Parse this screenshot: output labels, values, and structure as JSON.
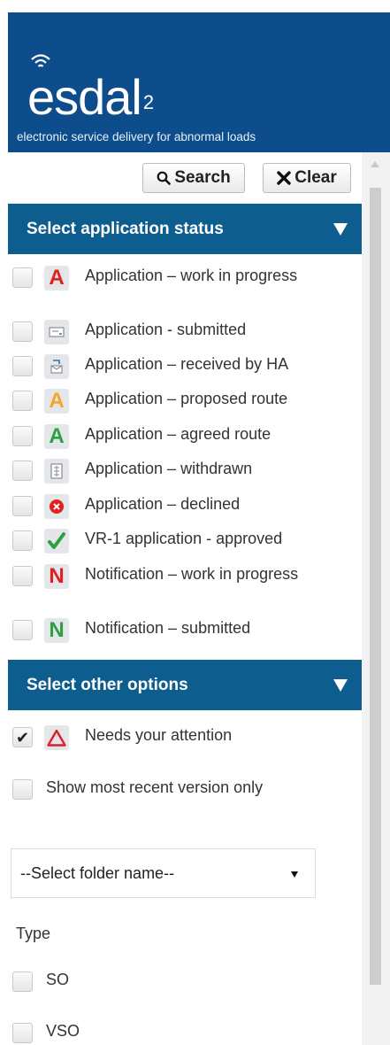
{
  "header": {
    "logo_text": "esdal",
    "logo_sup": "2",
    "tagline": "electronic service delivery for abnormal loads"
  },
  "toolbar": {
    "search_label": "Search",
    "clear_label": "Clear"
  },
  "status_section": {
    "title": "Select application status",
    "items": [
      {
        "label": "Application – work in progress",
        "icon": "letter-a-red-icon",
        "checked": false
      },
      {
        "label": "Application - submitted",
        "icon": "submitted-icon",
        "checked": false
      },
      {
        "label": "Application – received by HA",
        "icon": "received-icon",
        "checked": false
      },
      {
        "label": "Application – proposed route",
        "icon": "letter-a-orange-icon",
        "checked": false
      },
      {
        "label": "Application – agreed route",
        "icon": "letter-a-green-icon",
        "checked": false
      },
      {
        "label": "Application – withdrawn",
        "icon": "withdrawn-icon",
        "checked": false
      },
      {
        "label": "Application – declined",
        "icon": "declined-icon",
        "checked": false
      },
      {
        "label": "VR-1 application - approved",
        "icon": "tick-green-icon",
        "checked": false
      },
      {
        "label": "Notification – work in progress",
        "icon": "letter-n-red-icon",
        "checked": false
      },
      {
        "label": "Notification – submitted",
        "icon": "letter-n-green-icon",
        "checked": false
      }
    ]
  },
  "other_section": {
    "title": "Select other options",
    "attention_label": "Needs your attention",
    "attention_checked": true,
    "recent_label": "Show most recent version only",
    "recent_checked": false,
    "folder_select": "--Select folder name--",
    "type_label": "Type",
    "type_options": [
      {
        "label": "SO",
        "checked": false
      },
      {
        "label": "VSO",
        "checked": false
      }
    ]
  },
  "colors": {
    "header_bg": "#0d4d8c",
    "section_bg": "#0d5d8e",
    "red": "#e02020",
    "orange": "#f5a623",
    "green": "#2ea043"
  }
}
